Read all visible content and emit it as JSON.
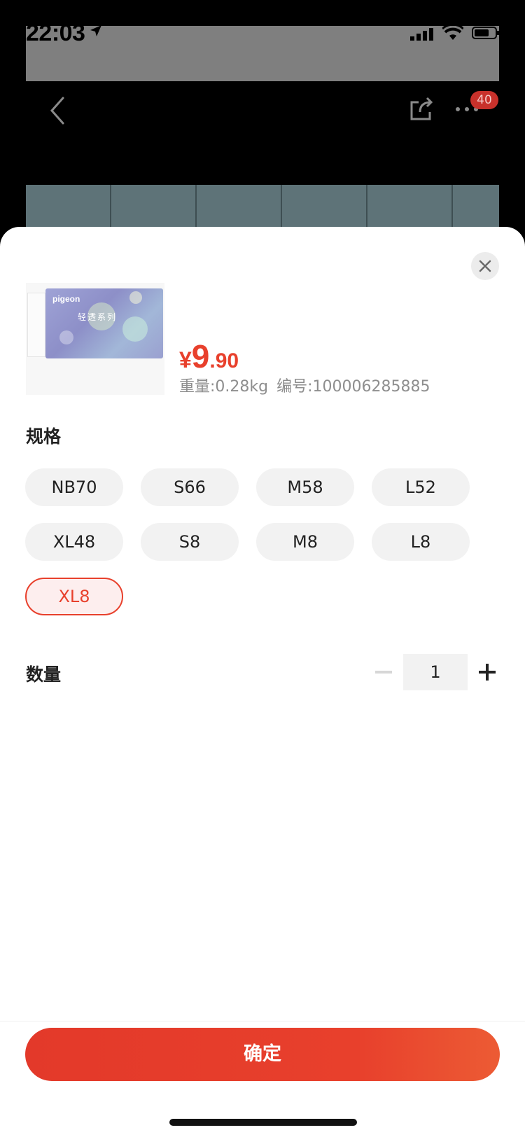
{
  "status_bar": {
    "time": "22:03",
    "icons": [
      "location-arrow-icon",
      "signal-icon",
      "wifi-icon",
      "battery-icon"
    ]
  },
  "nav": {
    "badge_count": "40",
    "icons": [
      "back-icon",
      "share-icon",
      "more-icon"
    ]
  },
  "product": {
    "thumb_logo": "pigeon",
    "thumb_series": "轻透系列",
    "price_currency": "¥",
    "price_integer": "9",
    "price_decimal": ".90",
    "weight": "重量:0.28kg",
    "code": "编号:100006285885"
  },
  "spec": {
    "label": "规格",
    "options": [
      "NB70",
      "S66",
      "M58",
      "L52",
      "XL48",
      "S8",
      "M8",
      "L8",
      "XL8"
    ],
    "selected": "XL8"
  },
  "quantity": {
    "label": "数量",
    "value": "1"
  },
  "confirm_label": "确定",
  "colors": {
    "accent": "#e8402c",
    "chip_bg": "#f2f2f2",
    "selected_chip_bg": "#fdeeee"
  }
}
